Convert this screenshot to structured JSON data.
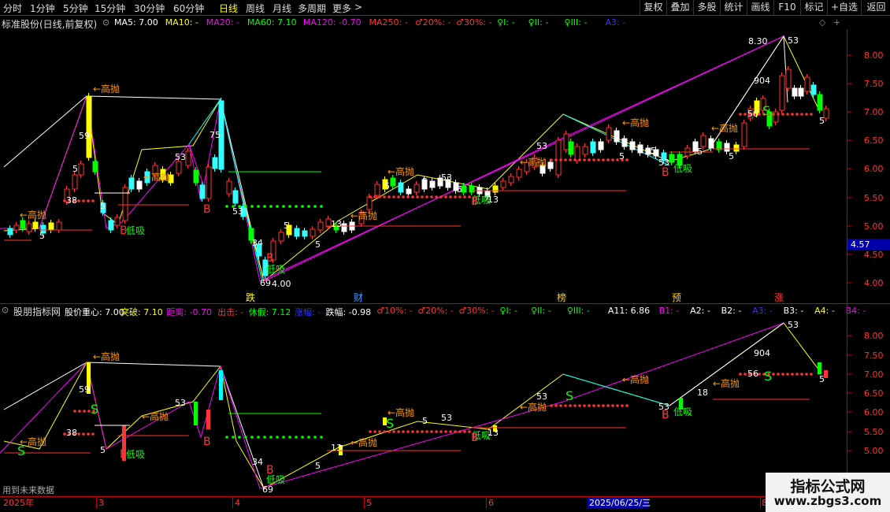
{
  "toolbar": {
    "tabs": [
      "分时",
      "1分钟",
      "5分钟",
      "15分钟",
      "30分钟",
      "60分钟",
      "日线",
      "周线",
      "月线",
      "多周期",
      "更多"
    ],
    "active_tab": "日线",
    "more_arrow": ">",
    "right_buttons": [
      "复权",
      "叠加",
      "多股",
      "统计",
      "画线",
      "F10",
      "标记",
      "+自选",
      "返回"
    ]
  },
  "main_panel": {
    "stock_name": "标准股份(日线,前复权)",
    "indicators": [
      {
        "label": "MA5: 7.00",
        "color": "#ffffff"
      },
      {
        "label": "MA10: -",
        "color": "#ffff00"
      },
      {
        "label": "MA20: -",
        "color": "#ff00ff"
      },
      {
        "label": "MA60: 7.10",
        "color": "#00ff00"
      },
      {
        "label": "MA120: -0.70",
        "color": "#ff00ff"
      },
      {
        "label": "MA250: -",
        "color": "#ff3333"
      },
      {
        "label": "♂20%: -",
        "color": "#ff3333"
      },
      {
        "label": "♂30%: -",
        "color": "#ff3333"
      },
      {
        "label": "♀I: -",
        "color": "#00ff00"
      },
      {
        "label": "♀II: -",
        "color": "#00ff00"
      },
      {
        "label": "♀III: -",
        "color": "#00ff00"
      },
      {
        "label": "A3: -",
        "color": "#3333ff"
      }
    ],
    "y_ticks": [
      "8.00",
      "7.50",
      "7.00",
      "6.50",
      "6.00",
      "5.50",
      "5.00",
      "4.50",
      "4.00"
    ],
    "price_tag": "4.57",
    "high_label": "8.30",
    "low_label": "4.00",
    "event_markers": [
      "跌",
      "财",
      "榜",
      "预",
      "涨"
    ]
  },
  "sub_panel": {
    "name": "股朋指标网",
    "indicators": [
      {
        "label": "股价重心: 7.00",
        "color": "#ffffff"
      },
      {
        "label": "突破: 7.10",
        "color": "#ffff00"
      },
      {
        "label": "距离: -0.70",
        "color": "#ff00ff"
      },
      {
        "label": "出击: -",
        "color": "#ff3333"
      },
      {
        "label": "休假: 7.12",
        "color": "#00ff00"
      },
      {
        "label": "涨幅: -",
        "color": "#3333ff"
      },
      {
        "label": "跌幅: -0.98",
        "color": "#ffffff"
      },
      {
        "label": "♂10%: -",
        "color": "#ff3333"
      },
      {
        "label": "♂20%: -",
        "color": "#ff3333"
      },
      {
        "label": "♂30%: -",
        "color": "#ff3333"
      },
      {
        "label": "♀I: -",
        "color": "#00ff00"
      },
      {
        "label": "♀II: -",
        "color": "#00ff00"
      },
      {
        "label": "♀III: -",
        "color": "#00ff00"
      },
      {
        "label": "A11: 6.86",
        "color": "#ffffff"
      },
      {
        "label": "B1: -",
        "color": "#ff00ff"
      },
      {
        "label": "A2: -",
        "color": "#ffffff"
      },
      {
        "label": "B2: -",
        "color": "#ffffff"
      },
      {
        "label": "A3: -",
        "color": "#3333ff"
      },
      {
        "label": "B3: -",
        "color": "#ffffff"
      },
      {
        "label": "A4: -",
        "color": "#ffff00"
      },
      {
        "label": "B4: -",
        "color": "#ff00ff"
      }
    ],
    "y_ticks": [
      "8.00",
      "7.50",
      "7.00",
      "6.50",
      "6.00",
      "5.50",
      "5.00"
    ],
    "footnote": "用到未来数据"
  },
  "date_axis": {
    "labels": [
      "2025年",
      "3",
      "4",
      "5",
      "6",
      "8"
    ],
    "cursor_date": "2025/06/25/三"
  },
  "signals": {
    "gao_pao": "高抛",
    "di_xi": "低吸",
    "buy": "B",
    "sell": "S"
  },
  "watermark": {
    "line1": "指标公式网",
    "line2": "www.zbgs3.com"
  },
  "colors": {
    "up": "#ff3333",
    "down": "#33ffff",
    "active_tab": "#ffff00",
    "price_tag_bg": "#0000aa"
  }
}
